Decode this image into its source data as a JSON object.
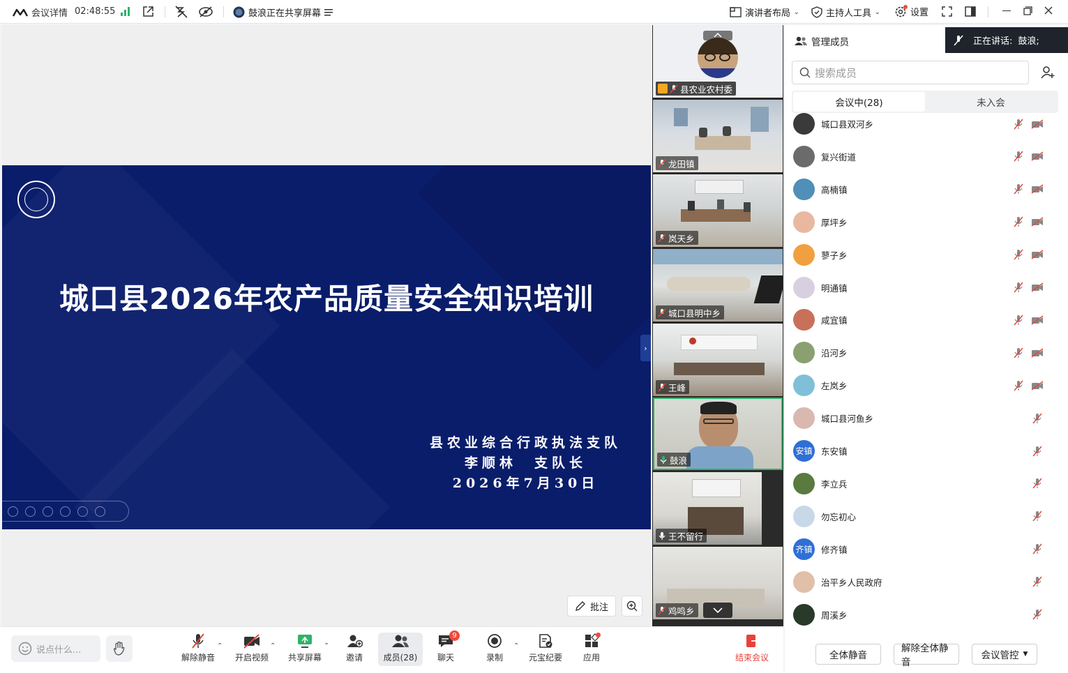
{
  "topbar": {
    "meeting_details": "会议详情",
    "timer": "02:48:55",
    "sharing_status": "鼓浪正在共享屏幕",
    "layout_label": "演讲者布局",
    "host_tools_label": "主持人工具",
    "settings_label": "设置"
  },
  "slide": {
    "title": "城口县2026年农产品质量安全知识培训",
    "line1": "县农业综合行政执法支队",
    "line2": "李顺林　支队长",
    "line3": "2026年7月30日"
  },
  "stage": {
    "annotate_label": "批注"
  },
  "thumbnails": [
    {
      "name": "县农业农村委",
      "kind": "avatar"
    },
    {
      "name": "龙田镇",
      "kind": "room"
    },
    {
      "name": "岚天乡",
      "kind": "room"
    },
    {
      "name": "城口县明中乡",
      "kind": "room"
    },
    {
      "name": "王峰",
      "kind": "room"
    },
    {
      "name": "鼓浪",
      "kind": "speaker"
    },
    {
      "name": "王不留行",
      "kind": "room"
    },
    {
      "name": "鸡鸣乡",
      "kind": "room"
    }
  ],
  "panel": {
    "manage_members": "管理成员",
    "speaking_prefix": "正在讲话:",
    "speaking_name": "鼓浪;",
    "search_placeholder": "搜索成员",
    "tab_in_meeting": "会议中(28)",
    "tab_not_joined": "未入会",
    "members": [
      {
        "name": "城口县双河乡",
        "avatar": "#3a3a3a",
        "camera_off": true
      },
      {
        "name": "复兴街道",
        "avatar": "#6b6b6b",
        "camera_off": true
      },
      {
        "name": "高楠镇",
        "avatar": "#4f8fb8",
        "camera_off": true
      },
      {
        "name": "厚坪乡",
        "avatar": "#e8b9a0",
        "camera_off": true
      },
      {
        "name": "蓼子乡",
        "avatar": "#f0a040",
        "camera_off": true
      },
      {
        "name": "明通镇",
        "avatar": "#d8d0e0",
        "camera_off": true
      },
      {
        "name": "咸宜镇",
        "avatar": "#c9705a",
        "camera_off": true
      },
      {
        "name": "沿河乡",
        "avatar": "#8aa070",
        "camera_off": true
      },
      {
        "name": "左岚乡",
        "avatar": "#7fc0d8",
        "camera_off": true
      },
      {
        "name": "城口县河鱼乡",
        "avatar": "#d9b8b0",
        "camera_off": false
      },
      {
        "name": "东安镇",
        "avatar": "#2f6fd6",
        "initials": "安镇",
        "camera_off": false
      },
      {
        "name": "李立兵",
        "avatar": "#5a7a40",
        "camera_off": false
      },
      {
        "name": "勿忘初心",
        "avatar": "#c8d8e8",
        "camera_off": false
      },
      {
        "name": "修齐镇",
        "avatar": "#2f6fd6",
        "initials": "齐镇",
        "camera_off": false
      },
      {
        "name": "治平乡人民政府",
        "avatar": "#e0c0a8",
        "camera_off": false
      },
      {
        "name": "周溪乡",
        "avatar": "#2a3a2a",
        "camera_off": false
      }
    ],
    "mute_all": "全体静音",
    "unmute_all": "解除全体静音",
    "meeting_control": "会议管控"
  },
  "toolbar": {
    "chat_placeholder": "说点什么...",
    "unmute": "解除静音",
    "start_video": "开启视频",
    "share_screen": "共享屏幕",
    "invite": "邀请",
    "members": "成员(28)",
    "chat": "聊天",
    "chat_badge": "9",
    "record": "录制",
    "ai_minutes": "元宝纪要",
    "apps": "应用",
    "end_meeting": "结束会议"
  },
  "colors": {
    "slide_bg": "#0a1d6b",
    "accent_green": "#2fb36b",
    "end_red": "#e8423a",
    "mute_red": "#e04a3c"
  }
}
